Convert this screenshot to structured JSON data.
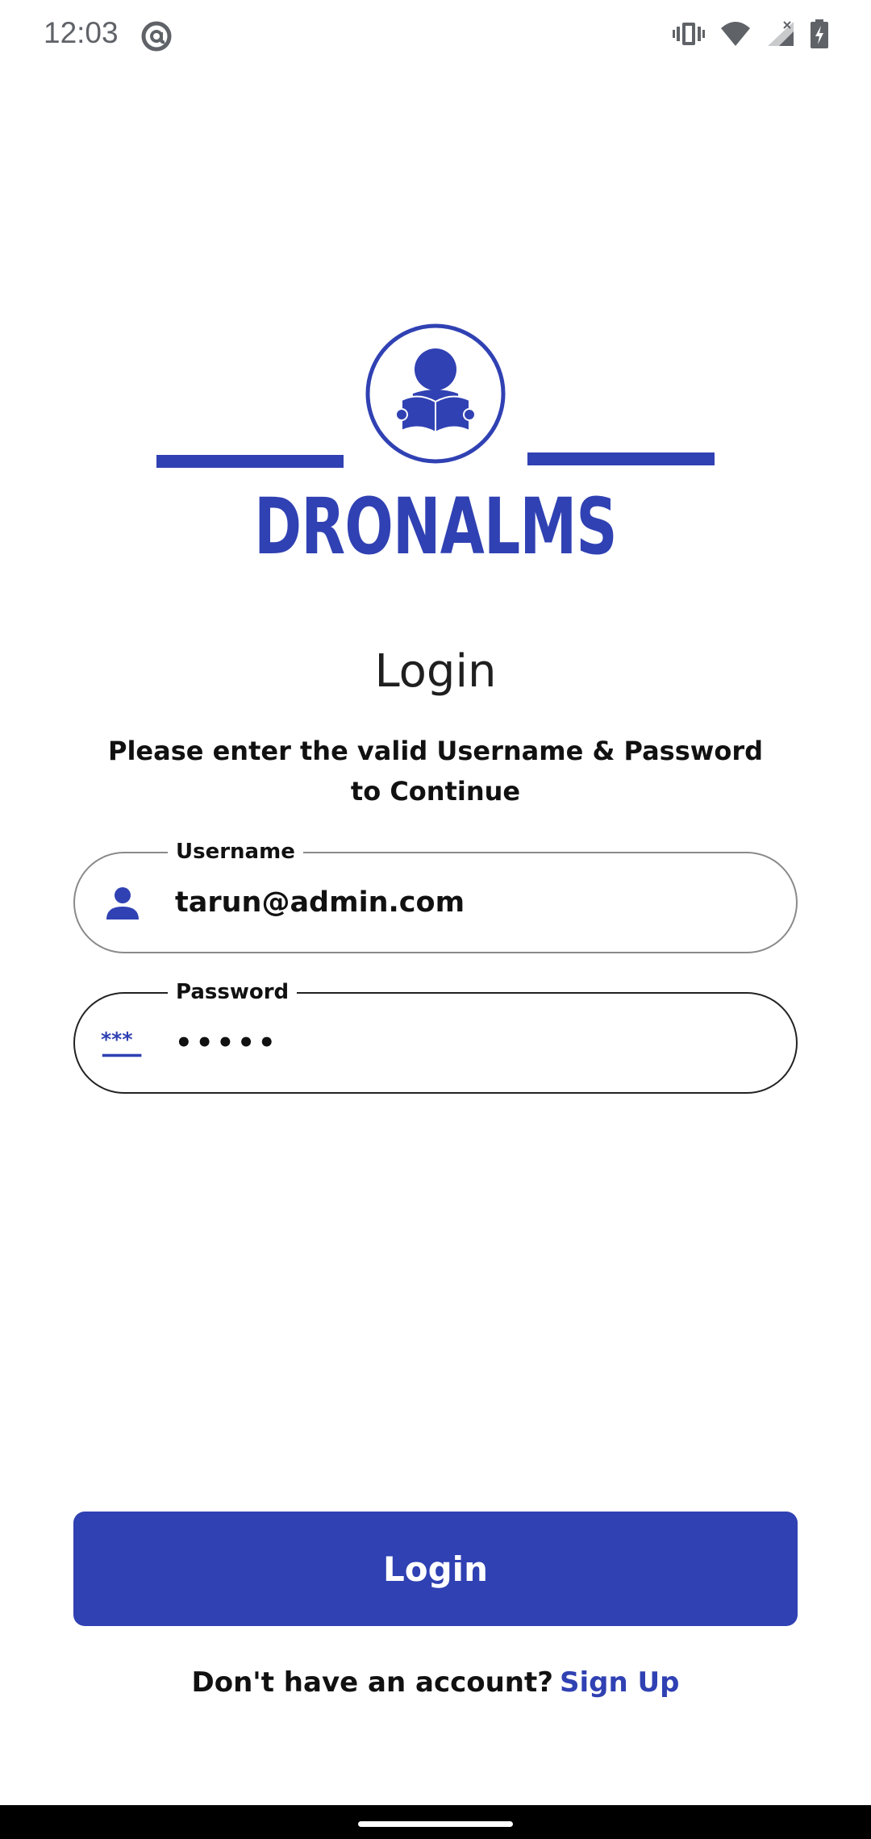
{
  "status_bar": {
    "time": "12:03",
    "icons": [
      "at-sign-icon",
      "vibrate-icon",
      "wifi-icon",
      "signal-icon",
      "battery-charging-icon"
    ]
  },
  "logo": {
    "wordmark": "DRONALMS",
    "brand_color": "#3041b3"
  },
  "page": {
    "title": "Login",
    "subtitle": "Please enter the valid Username & Password to Continue"
  },
  "form": {
    "username": {
      "label": "Username",
      "value": "tarun@admin.com",
      "icon": "person-icon"
    },
    "password": {
      "label": "Password",
      "value": "•••••",
      "icon": "password-dots-icon"
    }
  },
  "actions": {
    "login_label": "Login",
    "signup_prompt": "Don't have an account?",
    "signup_label": "Sign Up"
  },
  "colors": {
    "primary": "#3041b3",
    "text": "#111111",
    "status_text": "#5f6368"
  }
}
